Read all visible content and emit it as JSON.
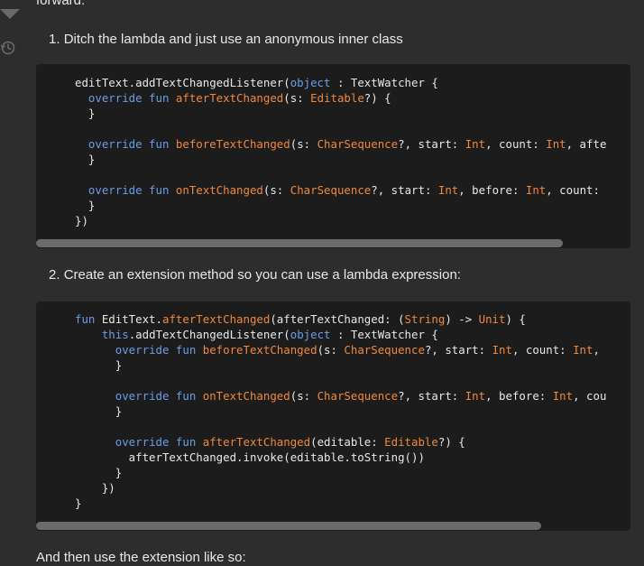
{
  "intro_text": "forward.",
  "steps": [
    {
      "number": "1.",
      "text": "Ditch the lambda and just use an anonymous inner class"
    },
    {
      "number": "2.",
      "text": "Create an extension method so you can use a lambda expression:"
    }
  ],
  "code1": [
    [
      [
        "pl",
        "editText.addTextChangedListener("
      ],
      [
        "kw",
        "object"
      ],
      [
        "pl",
        " : TextWatcher {"
      ]
    ],
    [
      [
        "pl",
        "  "
      ],
      [
        "kw",
        "override fun "
      ],
      [
        "fn",
        "afterTextChanged"
      ],
      [
        "pl",
        "(s: "
      ],
      [
        "ty",
        "Editable"
      ],
      [
        "pl",
        "?) {"
      ]
    ],
    [
      [
        "pl",
        "  }"
      ]
    ],
    [
      [
        "pl",
        ""
      ]
    ],
    [
      [
        "pl",
        "  "
      ],
      [
        "kw",
        "override fun "
      ],
      [
        "fn",
        "beforeTextChanged"
      ],
      [
        "pl",
        "(s: "
      ],
      [
        "ty",
        "CharSequence"
      ],
      [
        "pl",
        "?, start: "
      ],
      [
        "ty",
        "Int"
      ],
      [
        "pl",
        ", count: "
      ],
      [
        "ty",
        "Int"
      ],
      [
        "pl",
        ", afte"
      ]
    ],
    [
      [
        "pl",
        "  }"
      ]
    ],
    [
      [
        "pl",
        ""
      ]
    ],
    [
      [
        "pl",
        "  "
      ],
      [
        "kw",
        "override fun "
      ],
      [
        "fn",
        "onTextChanged"
      ],
      [
        "pl",
        "(s: "
      ],
      [
        "ty",
        "CharSequence"
      ],
      [
        "pl",
        "?, start: "
      ],
      [
        "ty",
        "Int"
      ],
      [
        "pl",
        ", before: "
      ],
      [
        "ty",
        "Int"
      ],
      [
        "pl",
        ", count:"
      ]
    ],
    [
      [
        "pl",
        "  }"
      ]
    ],
    [
      [
        "pl",
        "})"
      ]
    ]
  ],
  "code2": [
    [
      [
        "kw",
        "fun "
      ],
      [
        "pl",
        "EditText."
      ],
      [
        "fn",
        "afterTextChanged"
      ],
      [
        "pl",
        "(afterTextChanged: ("
      ],
      [
        "ty",
        "String"
      ],
      [
        "pl",
        ") -> "
      ],
      [
        "ty",
        "Unit"
      ],
      [
        "pl",
        ") {"
      ]
    ],
    [
      [
        "pl",
        "    "
      ],
      [
        "kw",
        "this"
      ],
      [
        "pl",
        ".addTextChangedListener("
      ],
      [
        "kw",
        "object"
      ],
      [
        "pl",
        " : TextWatcher {"
      ]
    ],
    [
      [
        "pl",
        "      "
      ],
      [
        "kw",
        "override fun "
      ],
      [
        "fn",
        "beforeTextChanged"
      ],
      [
        "pl",
        "(s: "
      ],
      [
        "ty",
        "CharSequence"
      ],
      [
        "pl",
        "?, start: "
      ],
      [
        "ty",
        "Int"
      ],
      [
        "pl",
        ", count: "
      ],
      [
        "ty",
        "Int"
      ],
      [
        "pl",
        ","
      ]
    ],
    [
      [
        "pl",
        "      }"
      ]
    ],
    [
      [
        "pl",
        ""
      ]
    ],
    [
      [
        "pl",
        "      "
      ],
      [
        "kw",
        "override fun "
      ],
      [
        "fn",
        "onTextChanged"
      ],
      [
        "pl",
        "(s: "
      ],
      [
        "ty",
        "CharSequence"
      ],
      [
        "pl",
        "?, start: "
      ],
      [
        "ty",
        "Int"
      ],
      [
        "pl",
        ", before: "
      ],
      [
        "ty",
        "Int"
      ],
      [
        "pl",
        ", cou"
      ]
    ],
    [
      [
        "pl",
        "      }"
      ]
    ],
    [
      [
        "pl",
        ""
      ]
    ],
    [
      [
        "pl",
        "      "
      ],
      [
        "kw",
        "override fun "
      ],
      [
        "fn",
        "afterTextChanged"
      ],
      [
        "pl",
        "(editable: "
      ],
      [
        "ty",
        "Editable"
      ],
      [
        "pl",
        "?) {"
      ]
    ],
    [
      [
        "pl",
        "        afterTextChanged.invoke(editable.toString())"
      ]
    ],
    [
      [
        "pl",
        "      }"
      ]
    ],
    [
      [
        "pl",
        "    })"
      ]
    ],
    [
      [
        "pl",
        "}"
      ]
    ]
  ],
  "outro_text": "And then use the extension like so:",
  "icons": {
    "downvote": "downvote-arrow-icon",
    "history": "history-icon"
  },
  "colors": {
    "background": "#2d2d2d",
    "code_background": "#1c1c1c",
    "keyword": "#6a9ee8",
    "function": "#f0883e",
    "text": "#e8e8e8"
  }
}
